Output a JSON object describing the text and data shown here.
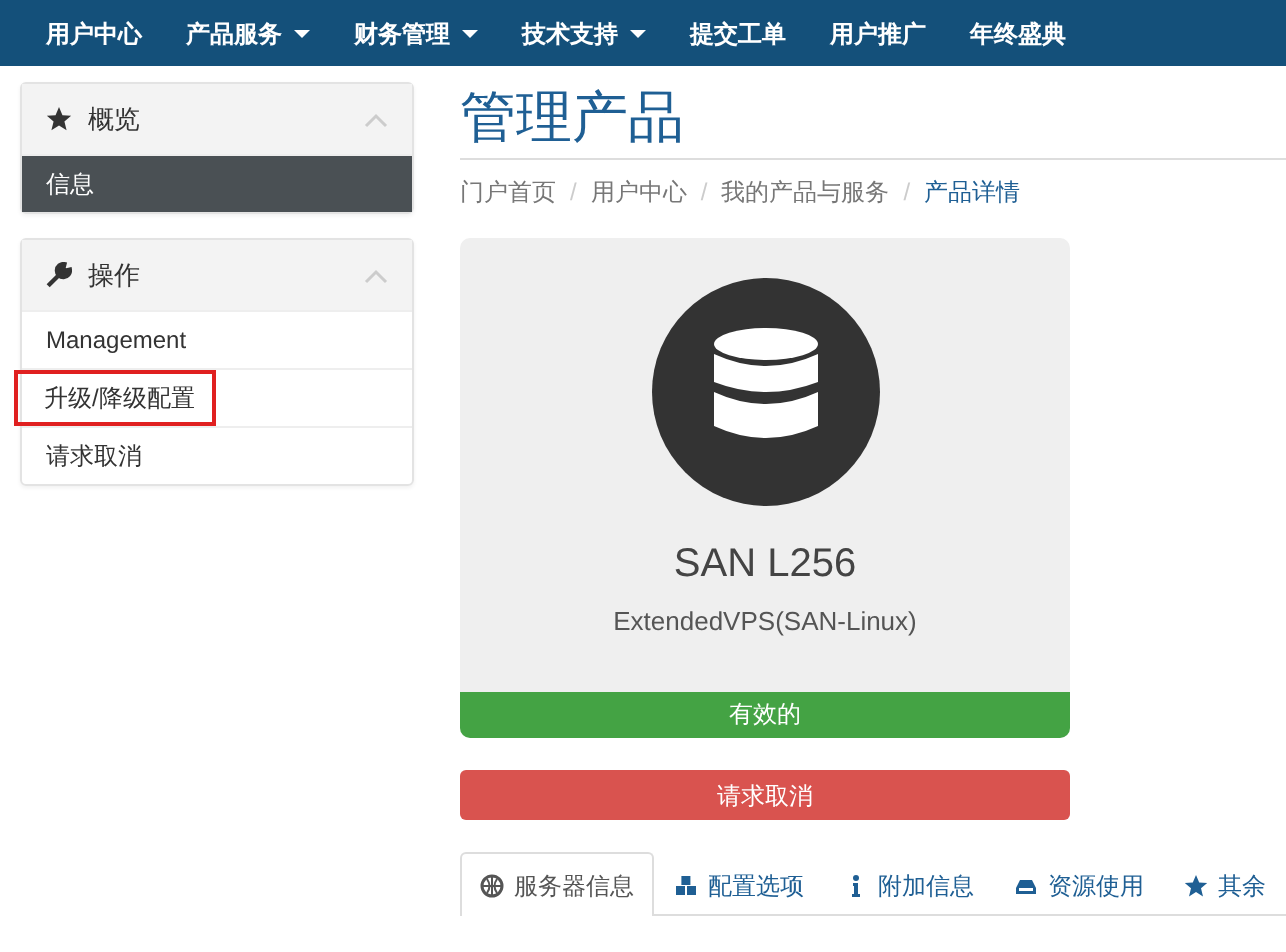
{
  "navbar": {
    "items": [
      {
        "label": "用户中心",
        "dropdown": false
      },
      {
        "label": "产品服务",
        "dropdown": true
      },
      {
        "label": "财务管理",
        "dropdown": true
      },
      {
        "label": "技术支持",
        "dropdown": true
      },
      {
        "label": "提交工单",
        "dropdown": false
      },
      {
        "label": "用户推广",
        "dropdown": false
      },
      {
        "label": "年终盛典",
        "dropdown": false
      }
    ]
  },
  "sidebar": {
    "panels": [
      {
        "title": "概览",
        "expanded": true,
        "items": [
          {
            "label": "信息",
            "selected": true,
            "highlighted": false
          }
        ]
      },
      {
        "title": "操作",
        "expanded": true,
        "items": [
          {
            "label": "Management",
            "selected": false,
            "highlighted": false
          },
          {
            "label": "升级/降级配置",
            "selected": false,
            "highlighted": true
          },
          {
            "label": "请求取消",
            "selected": false,
            "highlighted": false
          }
        ]
      }
    ]
  },
  "page_title": "管理产品",
  "breadcrumb": [
    {
      "label": "门户首页",
      "active": false
    },
    {
      "separator": "/",
      "label": "用户中心",
      "active": false
    },
    {
      "separator": "/",
      "label": "我的产品与服务",
      "active": false
    },
    {
      "separator": "/",
      "label": "产品详情",
      "active": true
    }
  ],
  "product": {
    "name": "SAN L256",
    "group": "ExtendedVPS(SAN-Linux)",
    "status": "有效的"
  },
  "cancel_button": "请求取消",
  "tabs": [
    {
      "label": "服务器信息",
      "selected": true
    },
    {
      "label": "配置选项",
      "selected": false
    },
    {
      "label": "附加信息",
      "selected": false
    },
    {
      "label": "资源使用",
      "selected": false
    },
    {
      "label": "其余",
      "selected": false
    }
  ]
}
